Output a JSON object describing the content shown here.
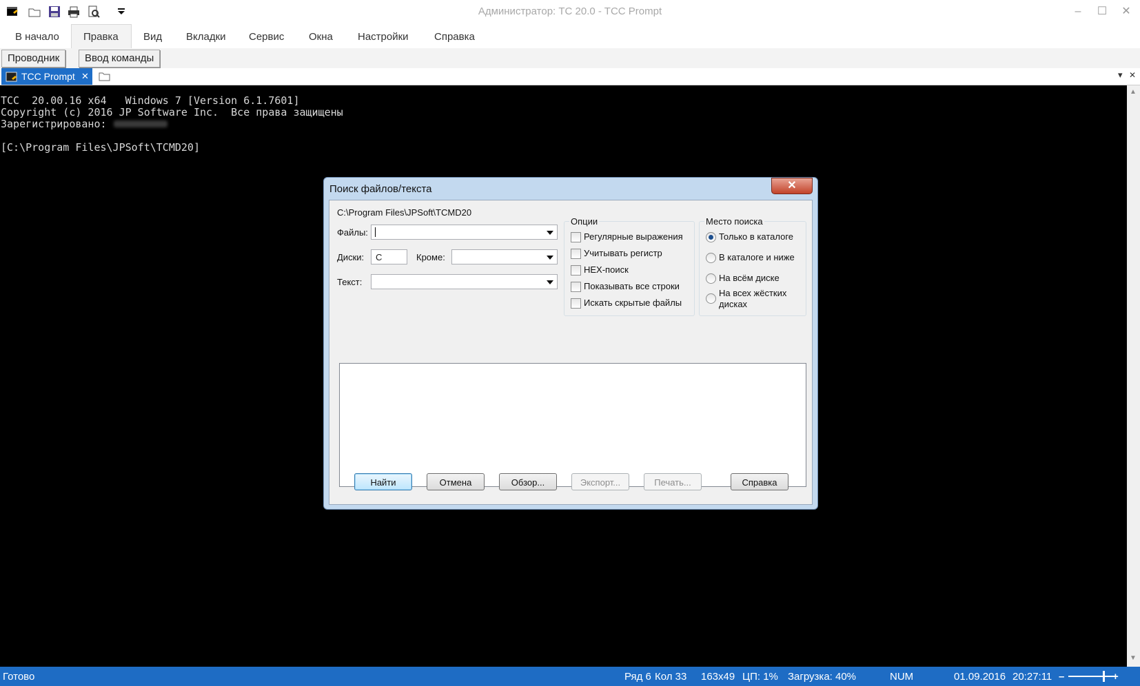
{
  "window": {
    "title": "Администратор: TC 20.0 - TCC Prompt",
    "minimize": "–",
    "maximize": "☐",
    "close": "✕"
  },
  "menu": [
    "В начало",
    "Правка",
    "Вид",
    "Вкладки",
    "Сервис",
    "Окна",
    "Настройки",
    "Справка"
  ],
  "ribbon": {
    "explorer": "Проводник",
    "command_input": "Ввод команды"
  },
  "tabs": {
    "active_label": "TCC Prompt",
    "close": "✕",
    "dropdown": "▾",
    "close_all": "✕"
  },
  "console": {
    "line1": "TCC  20.00.16 x64   Windows 7 [Version 6.1.7601]",
    "line2": "Copyright (c) 2016 JP Software Inc.  Все права защищены",
    "line3": "Зарегистрировано:",
    "line4": "[C:\\Program Files\\JPSoft\\TCMD20]"
  },
  "dialog": {
    "title": "Поиск файлов/текста",
    "close": "✕",
    "path": "C:\\Program Files\\JPSoft\\TCMD20",
    "files_label": "Файлы:",
    "files_value": "",
    "drives_label": "Диски:",
    "drives_value": "C",
    "except_label": "Кроме:",
    "except_value": "",
    "text_label": "Текст:",
    "text_value": "",
    "options": {
      "title": "Опции",
      "items": [
        {
          "label": "Регулярные выражения",
          "checked": false
        },
        {
          "label": "Учитывать регистр",
          "checked": false
        },
        {
          "label": "HEX-поиск",
          "checked": false
        },
        {
          "label": "Показывать все строки",
          "checked": false
        },
        {
          "label": "Искать скрытые файлы",
          "checked": false
        }
      ]
    },
    "location": {
      "title": "Место поиска",
      "items": [
        {
          "label": "Только в каталоге",
          "selected": true
        },
        {
          "label": "В каталоге и ниже",
          "selected": false
        },
        {
          "label": "На всём диске",
          "selected": false
        },
        {
          "label": "На всех жёстких",
          "label2": "дисках",
          "selected": false
        }
      ]
    },
    "buttons": {
      "find": "Найти",
      "cancel": "Отмена",
      "browse": "Обзор...",
      "export": "Экспорт...",
      "print": "Печать...",
      "help": "Справка"
    }
  },
  "status": {
    "state": "Готово",
    "row": "Ряд 6",
    "col": "Кол 33",
    "size": "163x49",
    "cpu": "ЦП:  1%",
    "load": "Загрузка: 40%",
    "num": "NUM",
    "date": "01.09.2016",
    "time": "20:27:11",
    "zoom_minus": "–",
    "zoom_plus": "+"
  },
  "colors": {
    "accent": "#1e6cc4",
    "console_bg": "#000000",
    "console_fg": "#d8d8d8"
  }
}
